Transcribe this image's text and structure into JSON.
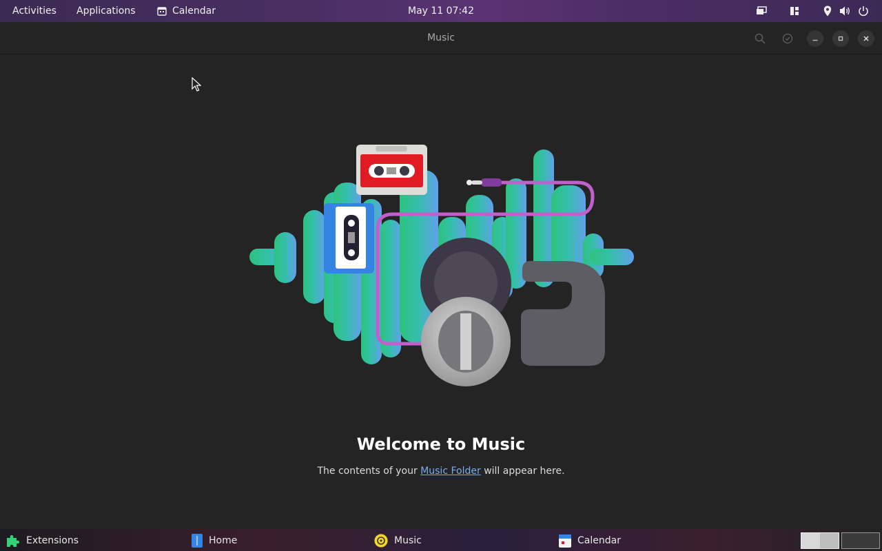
{
  "topbar": {
    "activities": "Activities",
    "applications": "Applications",
    "calendar": "Calendar",
    "clock": "May 11  07:42",
    "tray_icons": [
      "display-icon",
      "layout-icon",
      "location-icon",
      "volume-icon",
      "power-icon"
    ]
  },
  "window": {
    "title": "Music",
    "buttons": [
      "search-icon",
      "select-icon",
      "minimize-icon",
      "maximize-icon",
      "close-icon"
    ]
  },
  "main": {
    "welcome_title": "Welcome to Music",
    "sub_before": "The contents of your ",
    "sub_link": "Music Folder",
    "sub_after": " will appear here."
  },
  "taskbar": {
    "items": [
      {
        "label": "Extensions",
        "icon": "puzzle-icon"
      },
      {
        "label": "Home",
        "icon": "files-icon"
      },
      {
        "label": "Music",
        "icon": "music-icon"
      },
      {
        "label": "Calendar",
        "icon": "calendar-icon"
      }
    ]
  },
  "colors": {
    "accent_link": "#78aeed",
    "window_bg": "#242424"
  }
}
